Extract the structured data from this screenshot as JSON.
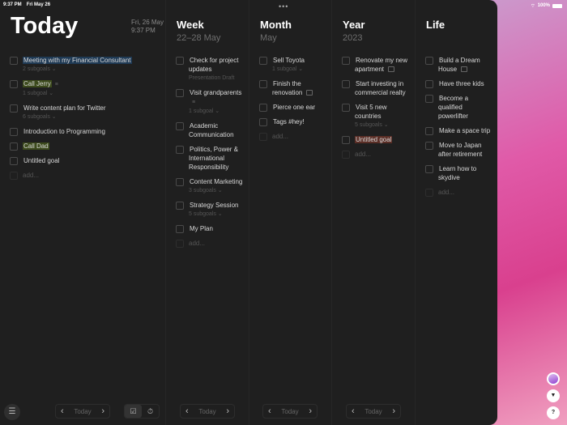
{
  "status": {
    "time": "9:37 PM",
    "date": "Fri May 26",
    "battery": "100%"
  },
  "today": {
    "title": "Today",
    "date": "Fri, 26 May",
    "time": "9:37 PM",
    "add": "add...",
    "items": [
      {
        "title": "Meeting with my Financial Consultant",
        "hl": "blue",
        "meta": "2 subgoals ⌄"
      },
      {
        "title": "Call Jerry",
        "hl": "green",
        "note": true,
        "meta": "1 subgoal ⌄"
      },
      {
        "title": "Write content plan for Twitter",
        "meta": "6 subgoals ⌄"
      },
      {
        "title": "Introduction to Programming"
      },
      {
        "title": "Call Dad",
        "hl": "green"
      },
      {
        "title": "Untitled goal"
      }
    ]
  },
  "week": {
    "title": "Week",
    "sub": "22–28 May",
    "add": "add...",
    "items": [
      {
        "title": "Check for project updates",
        "meta": "Presentation Draft"
      },
      {
        "title": "Visit grandparents",
        "note": true,
        "meta": "1 subgoal ⌄"
      },
      {
        "title": "Academic Communication"
      },
      {
        "title": "Politics, Power & International Responsibility"
      },
      {
        "title": "Content Marketing",
        "meta": "3 subgoals ⌄"
      },
      {
        "title": "Strategy Session",
        "meta": "5 subgoals ⌄"
      },
      {
        "title": "My Plan"
      }
    ]
  },
  "month": {
    "title": "Month",
    "sub": "May",
    "add": "add...",
    "items": [
      {
        "title": "Sell Toyota",
        "meta": "1 subgoal ⌄"
      },
      {
        "title": "Finish the renovation",
        "img": true
      },
      {
        "title": "Pierce one ear"
      },
      {
        "title": "Tags #hey!"
      }
    ]
  },
  "year": {
    "title": "Year",
    "sub": "2023",
    "add": "add...",
    "items": [
      {
        "title": "Renovate my new apartment",
        "img": true
      },
      {
        "title": "Start investing in commercial realty"
      },
      {
        "title": "Visit 5 new countries",
        "meta": "5 subgoals ⌄"
      },
      {
        "title": "Untitled goal",
        "hl": "red"
      }
    ]
  },
  "life": {
    "title": "Life",
    "add": "add...",
    "items": [
      {
        "title": "Build a Dream House",
        "img": true
      },
      {
        "title": "Have three kids"
      },
      {
        "title": "Become a qualified powerlifter"
      },
      {
        "title": "Make a space trip"
      },
      {
        "title": "Move to Japan after retirement"
      },
      {
        "title": "Learn how to skydive"
      }
    ]
  },
  "pager": {
    "label": "Today",
    "prev": "‹",
    "next": "›"
  },
  "icons": {
    "menu": "☰",
    "check": "☑",
    "timer": "⏱",
    "filter": "▼",
    "help": "?"
  }
}
